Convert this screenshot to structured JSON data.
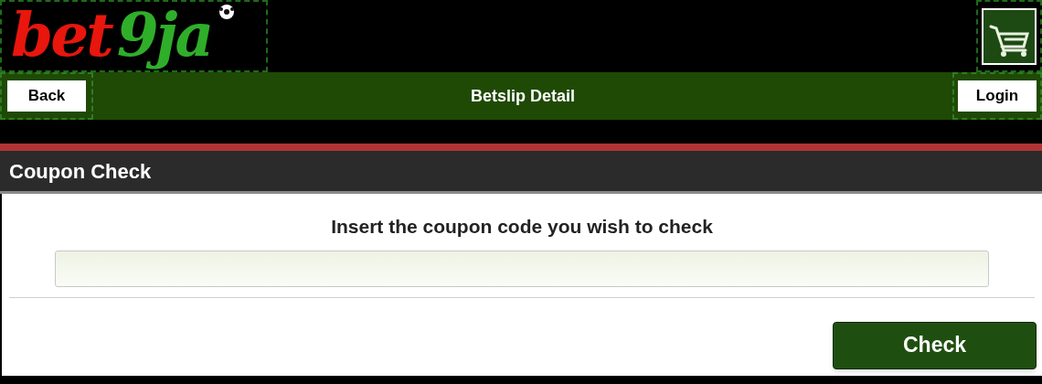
{
  "logo": {
    "parts": [
      {
        "text": "bet",
        "color": "#e8160c"
      },
      {
        "text": "9ja",
        "color": "#2fae2a"
      }
    ]
  },
  "nav": {
    "back": "Back",
    "title": "Betslip Detail",
    "login": "Login"
  },
  "section": {
    "title": "Coupon Check"
  },
  "form": {
    "prompt": "Insert the coupon code you wish to check",
    "button": "Check"
  }
}
